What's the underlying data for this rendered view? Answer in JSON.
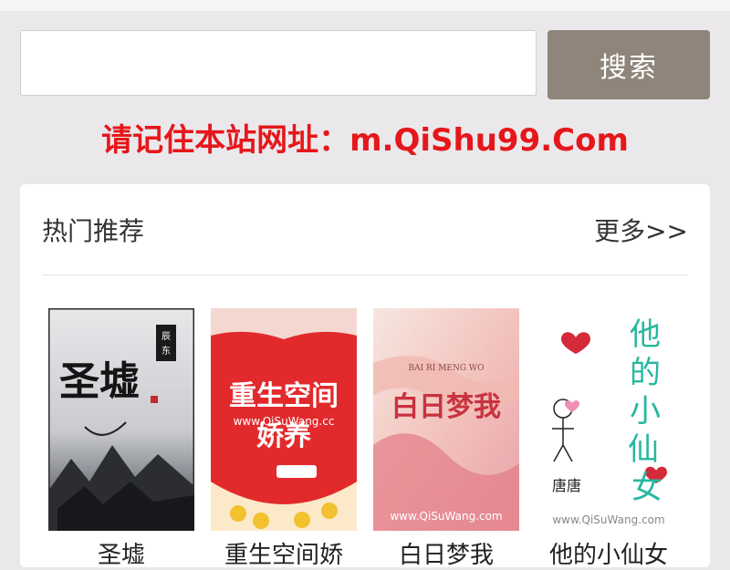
{
  "search": {
    "placeholder": "",
    "button_label": "搜索"
  },
  "notice": "请记住本站网址：m.QiShu99.Com",
  "panel": {
    "title": "热门推荐",
    "more_label": "更多>>"
  },
  "books": [
    {
      "title": "圣墟",
      "cover_text": "圣墟",
      "cover_badge": "辰东"
    },
    {
      "title": "重生空间娇",
      "cover_text": "重生空间",
      "cover_subtext": "娇养",
      "watermark": "www.QiSuWang.cc"
    },
    {
      "title": "白日梦我",
      "cover_text": "白日梦我",
      "cover_subtext": "BAI RI MENG WO",
      "watermark": "www.QiSuWang.com"
    },
    {
      "title": "他的小仙女",
      "cover_text": "他的小仙女",
      "cover_subtext": "唐唐",
      "watermark": "www.QiSuWang.com"
    }
  ],
  "colors": {
    "background": "#ebe8eb",
    "search_button": "#8f857a",
    "notice": "#e5171b"
  }
}
